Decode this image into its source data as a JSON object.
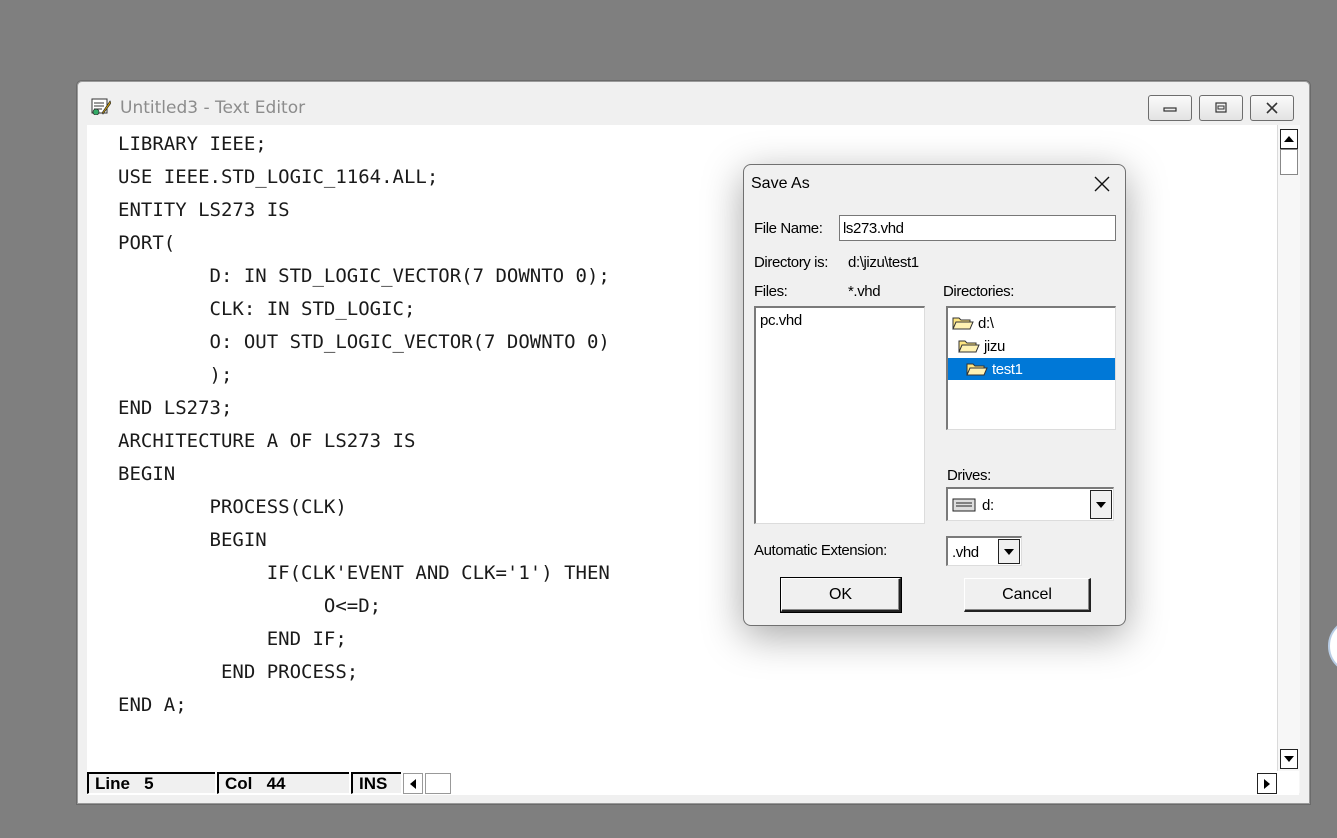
{
  "window": {
    "title": "Untitled3 - Text Editor",
    "icon": "editor-app-icon"
  },
  "editor": {
    "lines": [
      "LIBRARY IEEE;",
      "USE IEEE.STD_LOGIC_1164.ALL;",
      "ENTITY LS273 IS",
      "PORT(",
      "        D: IN STD_LOGIC_VECTOR(7 DOWNTO 0);",
      "        CLK: IN STD_LOGIC;",
      "        O: OUT STD_LOGIC_VECTOR(7 DOWNTO 0)",
      "        );",
      "END LS273;",
      "ARCHITECTURE A OF LS273 IS",
      "BEGIN",
      "        PROCESS(CLK)",
      "        BEGIN",
      "             IF(CLK'EVENT AND CLK='1') THEN",
      "                  O<=D;",
      "             END IF;",
      "         END PROCESS;",
      "END A;"
    ]
  },
  "statusbar": {
    "line_label": "Line",
    "line_value": "5",
    "col_label": "Col",
    "col_value": "44",
    "mode": "INS"
  },
  "dialog": {
    "title": "Save As",
    "file_name_label": "File Name:",
    "file_name_value": "ls273.vhd",
    "directory_label": "Directory is:",
    "directory_value": "d:\\jizu\\test1",
    "files_label": "Files:",
    "files_filter": "*.vhd",
    "files": [
      "pc.vhd"
    ],
    "directories_label": "Directories:",
    "directories": [
      "d:\\",
      "jizu",
      "test1"
    ],
    "selected_directory": "test1",
    "drives_label": "Drives:",
    "drive_value": "d:",
    "auto_ext_label": "Automatic Extension:",
    "auto_ext_value": ".vhd",
    "ok_label": "OK",
    "cancel_label": "Cancel",
    "selection_color": "#0078d7"
  }
}
